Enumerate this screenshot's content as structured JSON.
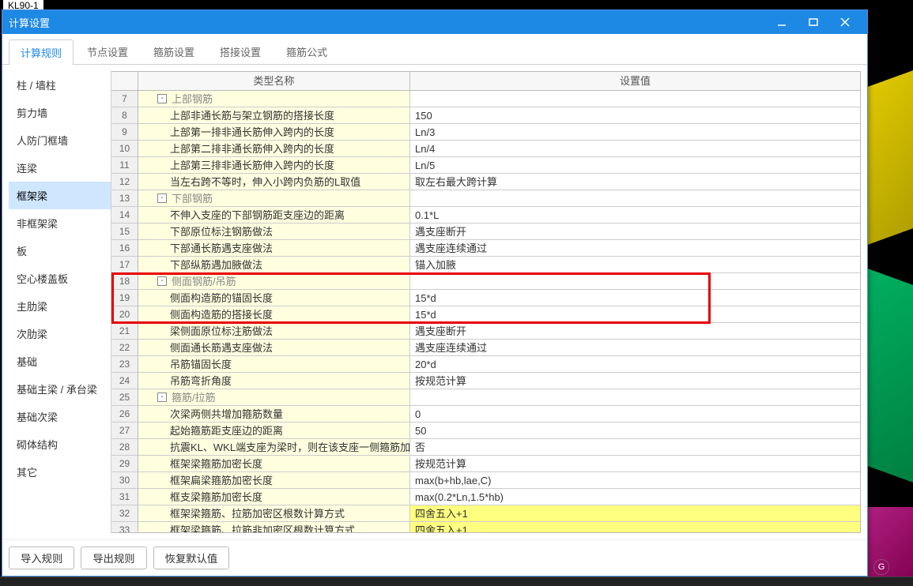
{
  "fragment_above": "KL90-1",
  "window": {
    "title": "计算设置"
  },
  "tabs": [
    "计算规则",
    "节点设置",
    "箍筋设置",
    "搭接设置",
    "箍筋公式"
  ],
  "active_tab": 0,
  "sidebar": {
    "items": [
      "柱 / 墙柱",
      "剪力墙",
      "人防门框墙",
      "连梁",
      "框架梁",
      "非框架梁",
      "板",
      "空心楼盖板",
      "主肋梁",
      "次肋梁",
      "基础",
      "基础主梁 / 承台梁",
      "基础次梁",
      "砌体结构",
      "其它"
    ],
    "active": 4
  },
  "grid": {
    "headers": {
      "c1": "类型名称",
      "c2": "设置值"
    },
    "rows": [
      {
        "n": 7,
        "group": true,
        "label": "上部钢筋",
        "value": ""
      },
      {
        "n": 8,
        "label": "上部非通长筋与架立钢筋的搭接长度",
        "value": "150"
      },
      {
        "n": 9,
        "label": "上部第一排非通长筋伸入跨内的长度",
        "value": "Ln/3"
      },
      {
        "n": 10,
        "label": "上部第二排非通长筋伸入跨内的长度",
        "value": "Ln/4"
      },
      {
        "n": 11,
        "label": "上部第三排非通长筋伸入跨内的长度",
        "value": "Ln/5"
      },
      {
        "n": 12,
        "label": "当左右跨不等时，伸入小跨内负筋的L取值",
        "value": "取左右最大跨计算"
      },
      {
        "n": 13,
        "group": true,
        "label": "下部钢筋",
        "value": ""
      },
      {
        "n": 14,
        "label": "不伸入支座的下部钢筋距支座边的距离",
        "value": "0.1*L"
      },
      {
        "n": 15,
        "label": "下部原位标注钢筋做法",
        "value": "遇支座断开"
      },
      {
        "n": 16,
        "label": "下部通长筋遇支座做法",
        "value": "遇支座连续通过"
      },
      {
        "n": 17,
        "label": "下部纵筋遇加腋做法",
        "value": "锚入加腋"
      },
      {
        "n": 18,
        "group": true,
        "label": "侧面钢筋/吊筋",
        "value": ""
      },
      {
        "n": 19,
        "label": "侧面构造筋的锚固长度",
        "value": "15*d"
      },
      {
        "n": 20,
        "label": "侧面构造筋的搭接长度",
        "value": "15*d"
      },
      {
        "n": 21,
        "label": "梁侧面原位标注筋做法",
        "value": "遇支座断开"
      },
      {
        "n": 22,
        "label": "侧面通长筋遇支座做法",
        "value": "遇支座连续通过"
      },
      {
        "n": 23,
        "label": "吊筋锚固长度",
        "value": "20*d"
      },
      {
        "n": 24,
        "label": "吊筋弯折角度",
        "value": "按规范计算"
      },
      {
        "n": 25,
        "group": true,
        "label": "箍筋/拉筋",
        "value": ""
      },
      {
        "n": 26,
        "label": "次梁两侧共增加箍筋数量",
        "value": "0"
      },
      {
        "n": 27,
        "label": "起始箍筋距支座边的距离",
        "value": "50"
      },
      {
        "n": 28,
        "label": "抗震KL、WKL端支座为梁时，则在该支座一侧箍筋加密",
        "value": "否"
      },
      {
        "n": 29,
        "label": "框架梁箍筋加密长度",
        "value": "按规范计算"
      },
      {
        "n": 30,
        "label": "框架扁梁箍筋加密长度",
        "value": "max(b+hb,lae,C)"
      },
      {
        "n": 31,
        "label": "框支梁箍筋加密长度",
        "value": "max(0.2*Ln,1.5*hb)"
      },
      {
        "n": 32,
        "label": "框架梁箍筋、拉筋加密区根数计算方式",
        "value": "四舍五入+1",
        "hl": true
      },
      {
        "n": 33,
        "label": "框架梁箍筋、拉筋非加密区根数计算方式",
        "value": "四舍五入+1",
        "hl": true
      }
    ]
  },
  "footer": {
    "import": "导入规则",
    "export": "导出规则",
    "reset": "恢复默认值"
  },
  "indicator": "G",
  "highlight_box": {
    "top_row_n": 18,
    "rows": 3
  }
}
